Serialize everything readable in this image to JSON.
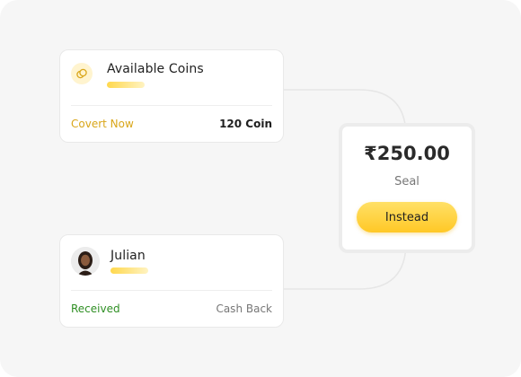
{
  "coins_card": {
    "title": "Available Coins",
    "action_label": "Covert Now",
    "coin_amount": "120 Coin",
    "icon": "coin-icon"
  },
  "user_card": {
    "name": "Julian",
    "status": "Received",
    "type": "Cash Back",
    "icon": "avatar"
  },
  "price_card": {
    "amount": "₹250.00",
    "label": "Seal",
    "button_label": "Instead"
  },
  "colors": {
    "accent": "#ffc826",
    "covert_text": "#d9a61a",
    "received_text": "#2f8f24",
    "background": "#f6f6f6"
  }
}
